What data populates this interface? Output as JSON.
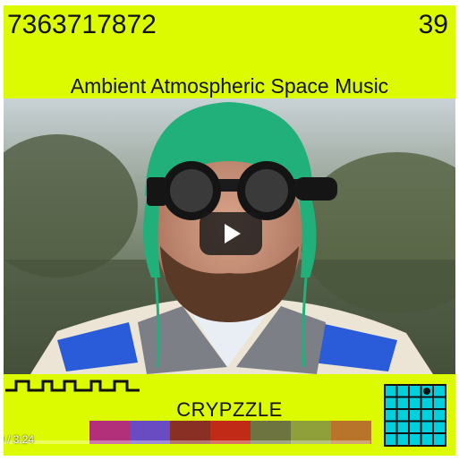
{
  "header": {
    "left_number": "7363717872",
    "right_number": "39"
  },
  "title": "Ambient Atmospheric Space Music",
  "video": {
    "play_icon": "play-icon"
  },
  "player": {
    "time": "0 / 3:24",
    "progress": 0.0
  },
  "brand": "CRYPZZLE",
  "palette": [
    "#b2307a",
    "#6a4cc2",
    "#8a2f24",
    "#c12a16",
    "#6d7440",
    "#8fa03a",
    "#b7742a"
  ],
  "colors": {
    "background": "#ddfb00",
    "grid_cell": "#00d0dc",
    "text": "#111111"
  },
  "icons": [
    "wave-icon",
    "grid-icon",
    "play-icon"
  ]
}
